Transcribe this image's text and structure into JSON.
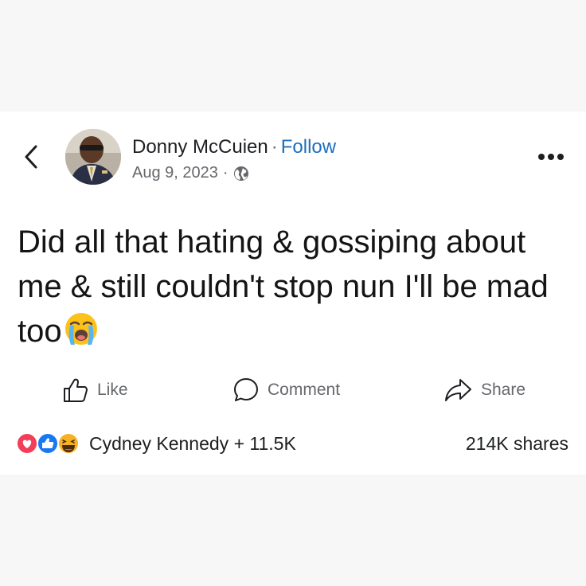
{
  "post": {
    "author": "Donny McCuien",
    "separator": "·",
    "follow_label": "Follow",
    "date": "Aug 9, 2023",
    "meta_separator": "·",
    "audience_icon": "globe-icon",
    "text": "Did all that hating & gossiping about me & still couldn't stop nun I'll be mad too",
    "text_emoji": "loudly-crying-face-emoji"
  },
  "actions": {
    "like_label": "Like",
    "comment_label": "Comment",
    "share_label": "Share"
  },
  "footer": {
    "reaction_icons": [
      "love-reaction-icon",
      "like-reaction-icon",
      "haha-reaction-icon"
    ],
    "reactors_text": "Cydney Kennedy + 11.5K",
    "shares_text": "214K shares"
  },
  "colors": {
    "follow": "#1d6fbf",
    "muted": "#65676b",
    "love": "#f33e58",
    "like": "#1877f2",
    "haha": "#f7b125"
  }
}
